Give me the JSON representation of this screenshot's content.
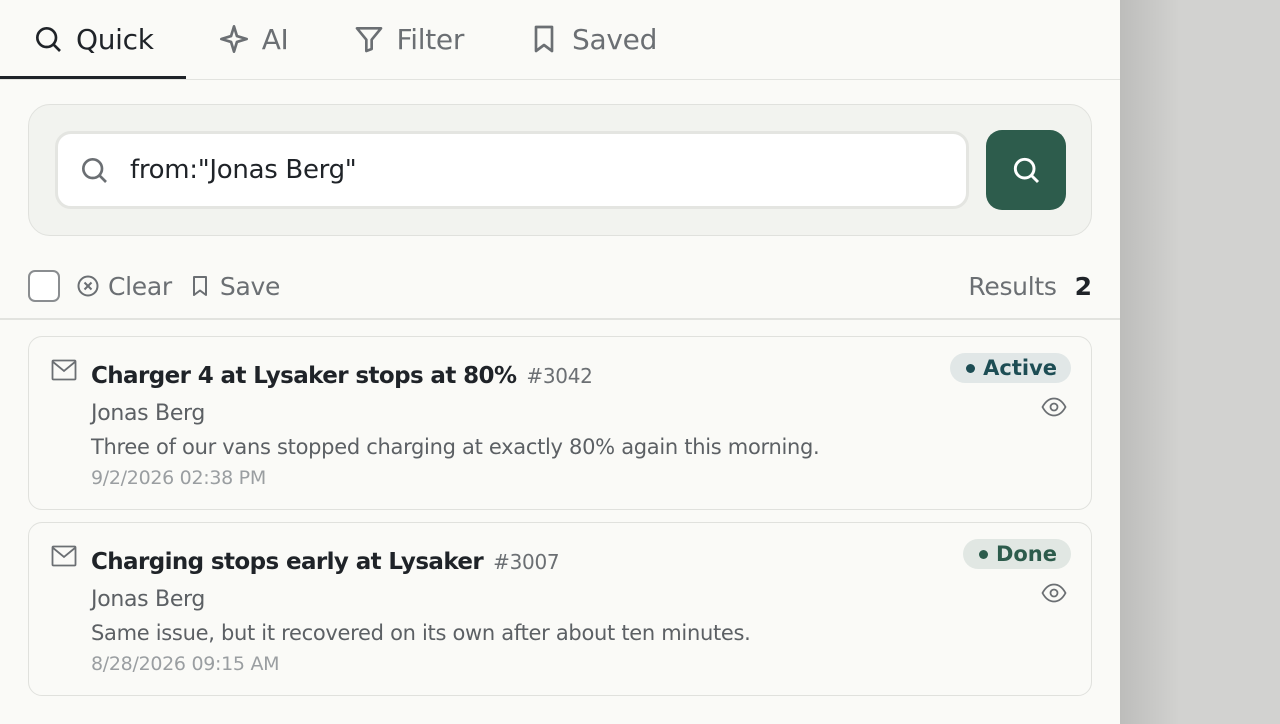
{
  "tabs": [
    {
      "label": "Quick",
      "icon": "search-icon",
      "active": true
    },
    {
      "label": "AI",
      "icon": "sparkle-icon",
      "active": false
    },
    {
      "label": "Filter",
      "icon": "filter-icon",
      "active": false
    },
    {
      "label": "Saved",
      "icon": "bookmark-icon",
      "active": false
    }
  ],
  "search": {
    "value": "from:\"Jonas Berg\"",
    "placeholder": ""
  },
  "toolbar": {
    "clear_label": "Clear",
    "save_label": "Save",
    "results_label": "Results",
    "results_count": "2"
  },
  "messages": [
    {
      "title": "Charger 4 at Lysaker stops at 80%",
      "number": "#3042",
      "sender": "Jonas Berg",
      "snippet": "Three of our vans stopped charging at exactly 80% again this morning.",
      "date": "9/2/2026  02:38 PM",
      "status": "Active"
    },
    {
      "title": "Charging stops early at Lysaker",
      "number": "#3007",
      "sender": "Jonas Berg",
      "snippet": "Same issue, but it recovered on its own after about ten minutes.",
      "date": "8/28/2026  09:15 AM",
      "status": "Done"
    }
  ],
  "colors": {
    "accent": "#2d5c4c",
    "active_badge": "#1d4d54",
    "done_badge": "#2d5c4c"
  }
}
